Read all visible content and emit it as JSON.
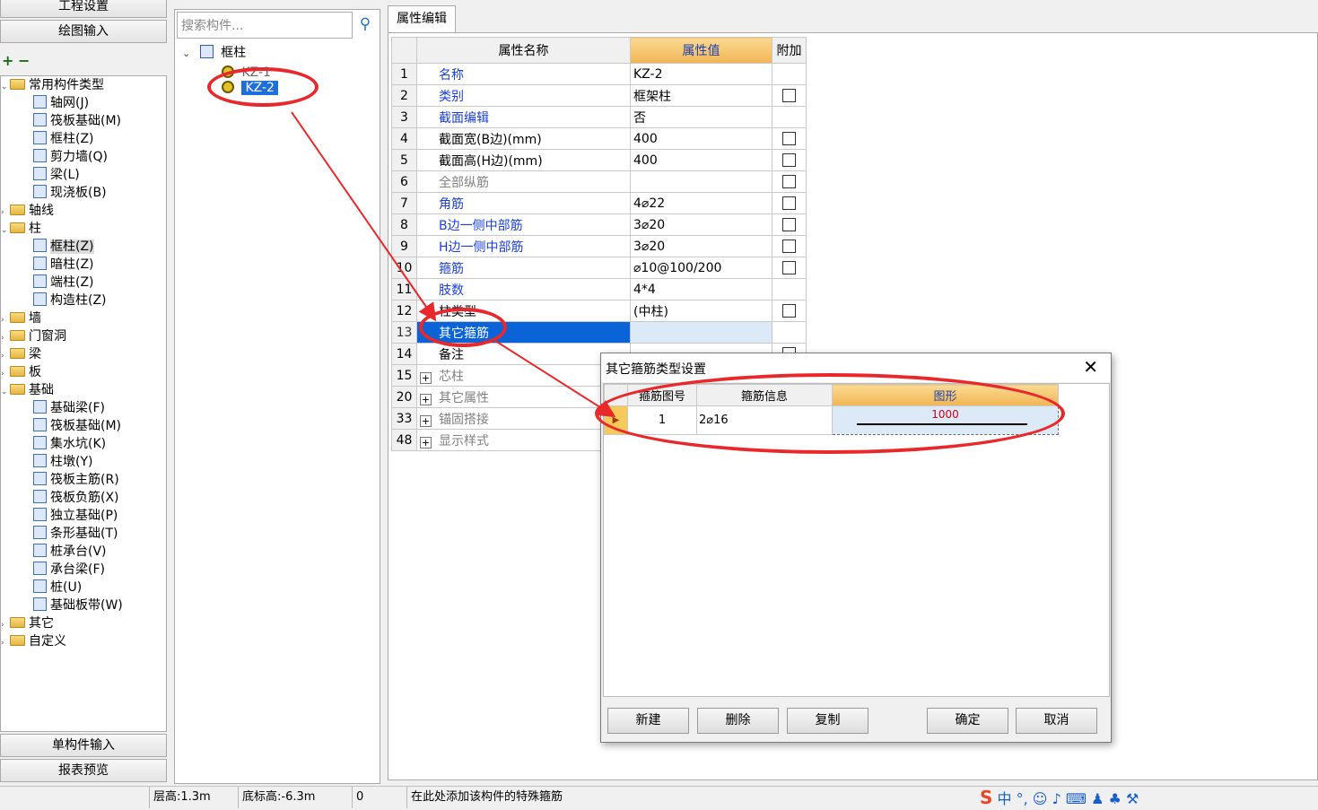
{
  "left_nav": {
    "top_button_1": "工程设置",
    "top_button_2": "绘图输入",
    "toolbar": {
      "add": "+",
      "collapse": "−"
    },
    "bottom_button_1": "单构件输入",
    "bottom_button_2": "报表预览",
    "tree": [
      {
        "label": "常用构件类型",
        "level": 0,
        "type": "folder-open"
      },
      {
        "label": "轴网(J)",
        "level": 1,
        "type": "comp"
      },
      {
        "label": "筏板基础(M)",
        "level": 1,
        "type": "comp"
      },
      {
        "label": "框柱(Z)",
        "level": 1,
        "type": "comp"
      },
      {
        "label": "剪力墙(Q)",
        "level": 1,
        "type": "comp"
      },
      {
        "label": "梁(L)",
        "level": 1,
        "type": "comp"
      },
      {
        "label": "现浇板(B)",
        "level": 1,
        "type": "comp"
      },
      {
        "label": "轴线",
        "level": 0,
        "type": "folder"
      },
      {
        "label": "柱",
        "level": 0,
        "type": "folder-open"
      },
      {
        "label": "框柱(Z)",
        "level": 1,
        "type": "comp",
        "selected": true
      },
      {
        "label": "暗柱(Z)",
        "level": 1,
        "type": "comp"
      },
      {
        "label": "端柱(Z)",
        "level": 1,
        "type": "comp"
      },
      {
        "label": "构造柱(Z)",
        "level": 1,
        "type": "comp"
      },
      {
        "label": "墙",
        "level": 0,
        "type": "folder"
      },
      {
        "label": "门窗洞",
        "level": 0,
        "type": "folder"
      },
      {
        "label": "梁",
        "level": 0,
        "type": "folder"
      },
      {
        "label": "板",
        "level": 0,
        "type": "folder"
      },
      {
        "label": "基础",
        "level": 0,
        "type": "folder-open"
      },
      {
        "label": "基础梁(F)",
        "level": 1,
        "type": "comp"
      },
      {
        "label": "筏板基础(M)",
        "level": 1,
        "type": "comp"
      },
      {
        "label": "集水坑(K)",
        "level": 1,
        "type": "comp"
      },
      {
        "label": "柱墩(Y)",
        "level": 1,
        "type": "comp"
      },
      {
        "label": "筏板主筋(R)",
        "level": 1,
        "type": "comp"
      },
      {
        "label": "筏板负筋(X)",
        "level": 1,
        "type": "comp"
      },
      {
        "label": "独立基础(P)",
        "level": 1,
        "type": "comp"
      },
      {
        "label": "条形基础(T)",
        "level": 1,
        "type": "comp"
      },
      {
        "label": "桩承台(V)",
        "level": 1,
        "type": "comp"
      },
      {
        "label": "承台梁(F)",
        "level": 1,
        "type": "comp"
      },
      {
        "label": "桩(U)",
        "level": 1,
        "type": "comp"
      },
      {
        "label": "基础板带(W)",
        "level": 1,
        "type": "comp"
      },
      {
        "label": "其它",
        "level": 0,
        "type": "folder"
      },
      {
        "label": "自定义",
        "level": 0,
        "type": "folder"
      }
    ]
  },
  "component_tree": {
    "search_placeholder": "搜索构件...",
    "root_label": "框柱",
    "items": [
      "KZ-1",
      "KZ-2"
    ],
    "selected_item": "KZ-2"
  },
  "property_editor": {
    "tab_label": "属性编辑",
    "headers": {
      "name": "属性名称",
      "value": "属性值",
      "extra": "附加"
    },
    "rows": [
      {
        "num": "1",
        "name": "名称",
        "value": "KZ-2",
        "name_style": "blue",
        "checkbox": false
      },
      {
        "num": "2",
        "name": "类别",
        "value": "框架柱",
        "name_style": "blue",
        "checkbox": true
      },
      {
        "num": "3",
        "name": "截面编辑",
        "value": "否",
        "name_style": "blue",
        "checkbox": false
      },
      {
        "num": "4",
        "name": "截面宽(B边)(mm)",
        "value": "400",
        "name_style": "black",
        "checkbox": true
      },
      {
        "num": "5",
        "name": "截面高(H边)(mm)",
        "value": "400",
        "name_style": "black",
        "checkbox": true
      },
      {
        "num": "6",
        "name": "全部纵筋",
        "value": "",
        "name_style": "gray",
        "checkbox": true
      },
      {
        "num": "7",
        "name": "角筋",
        "value": "4⌀22",
        "name_style": "blue",
        "checkbox": true
      },
      {
        "num": "8",
        "name": "B边一侧中部筋",
        "value": "3⌀20",
        "name_style": "blue",
        "checkbox": true
      },
      {
        "num": "9",
        "name": "H边一侧中部筋",
        "value": "3⌀20",
        "name_style": "blue",
        "checkbox": true
      },
      {
        "num": "10",
        "name": "箍筋",
        "value": "⌀10@100/200",
        "name_style": "blue",
        "checkbox": true
      },
      {
        "num": "11",
        "name": "肢数",
        "value": "4*4",
        "name_style": "blue",
        "checkbox": false
      },
      {
        "num": "12",
        "name": "柱类型",
        "value": "(中柱)",
        "name_style": "black",
        "checkbox": true
      },
      {
        "num": "13",
        "name": "其它箍筋",
        "value": "",
        "name_style": "blue",
        "checkbox": false,
        "selected": true
      },
      {
        "num": "14",
        "name": "备注",
        "value": "",
        "name_style": "black",
        "checkbox": true
      },
      {
        "num": "15",
        "name": "芯柱",
        "value": "",
        "name_style": "gray",
        "checkbox": false,
        "group": true
      },
      {
        "num": "20",
        "name": "其它属性",
        "value": "",
        "name_style": "gray",
        "checkbox": false,
        "group": true
      },
      {
        "num": "33",
        "name": "锚固搭接",
        "value": "",
        "name_style": "gray",
        "checkbox": false,
        "group": true
      },
      {
        "num": "48",
        "name": "显示样式",
        "value": "",
        "name_style": "gray",
        "checkbox": false,
        "group": true
      }
    ]
  },
  "dialog": {
    "title": "其它箍筋类型设置",
    "close": "✕",
    "headers": {
      "shape_no": "箍筋图号",
      "info": "箍筋信息",
      "shape": "图形"
    },
    "rows": [
      {
        "shape_no": "1",
        "info": "2⌀16",
        "shape_value": "1000"
      }
    ],
    "buttons": {
      "new": "新建",
      "delete": "删除",
      "copy": "复制",
      "ok": "确定",
      "cancel": "取消"
    }
  },
  "status_bar": {
    "floor_height": "层高:1.3m",
    "bottom_elevation": "底标高:-6.3m",
    "count": "0",
    "hint": "在此处添加该构件的特殊箍筋"
  },
  "colors": {
    "selection_blue": "#0a64d8",
    "header_orange": "#f1b655",
    "annotation_red": "#e8282b",
    "link_blue": "#1a3fd0"
  }
}
